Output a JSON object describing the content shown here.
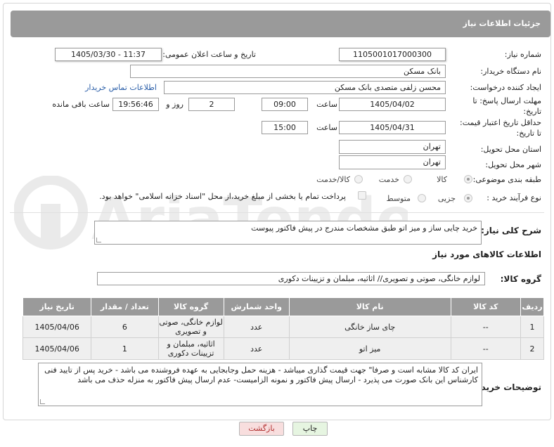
{
  "header": {
    "title": "جزئیات اطلاعات نیاز"
  },
  "fields": {
    "need_number_label": "شماره نیاز:",
    "need_number": "1105001017000300",
    "announce_label": "تاریخ و ساعت اعلان عمومی:",
    "announce_value": "1405/03/30 - 11:37",
    "buyer_org_label": "نام دستگاه خریدار:",
    "buyer_org": "بانک مسکن",
    "requester_label": "ایجاد کننده درخواست:",
    "requester": "محسن زلفی متصدی بانک مسکن",
    "contact_link": "اطلاعات تماس خریدار",
    "deadline_label_1": "مهلت ارسال پاسخ: تا",
    "deadline_label_2": "تاریخ:",
    "deadline_date": "1405/04/02",
    "deadline_time_label": "ساعت",
    "deadline_time": "09:00",
    "deadline_days": "2",
    "deadline_days_label": "روز و",
    "deadline_remaining": "19:56:46",
    "deadline_remaining_label": "ساعت باقی مانده",
    "validity_label_1": "حداقل تاریخ اعتبار قیمت:",
    "validity_label_2": "تا تاریخ:",
    "validity_date": "1405/04/31",
    "validity_time_label": "ساعت",
    "validity_time": "15:00",
    "province_label": "استان محل تحویل:",
    "province": "تهران",
    "city_label": "شهر محل تحویل:",
    "city": "تهران",
    "category_label": "طبقه بندی موضوعی:",
    "category_options": [
      "کالا",
      "خدمت",
      "کالا/خدمت"
    ],
    "process_label": "نوع فرآیند خرید :",
    "process_options": [
      "جزیی",
      "متوسط"
    ],
    "payment_text": "پرداخت تمام یا بخشی از مبلغ خرید،از محل \"اسناد خزانه اسلامی\" خواهد بود."
  },
  "summary": {
    "label": "شرح کلی نیاز:",
    "text": "خرید چایی ساز و میز اتو طبق مشخصات مندرج در پیش فاکتور پیوست"
  },
  "goods_info_title": "اطلاعات کالاهای مورد نیاز",
  "goods_group": {
    "label": "گروه کالا:",
    "value": "لوازم خانگی، صوتی و تصویری// اثاثیه، مبلمان و تزیینات دکوری"
  },
  "table": {
    "headers": [
      "ردیف",
      "کد کالا",
      "نام کالا",
      "واحد شمارش",
      "گروه کالا",
      "تعداد / مقدار",
      "تاریخ نیاز"
    ],
    "rows": [
      [
        "1",
        "--",
        "چای ساز خانگی",
        "عدد",
        "لوازم خانگی، صوتی و تصویری",
        "6",
        "1405/04/06"
      ],
      [
        "2",
        "--",
        "میز اتو",
        "عدد",
        "اثاثیه، مبلمان و تزیینات دکوری",
        "1",
        "1405/04/06"
      ]
    ]
  },
  "buyer_notes": {
    "label": "توضیحات خریدار:",
    "text": "ایران کد کالا مشابه است و صرفا\" جهت قیمت گذاری میباشد - هزینه حمل وجابجایی به عهده فروشنده می باشد - خرید پس از تایید فنی کارشناس این بانک صورت می پذیرد - ارسال پیش فاکتور و نمونه الزامیست- عدم ارسال پیش فاکتور به منزله حذف می باشد"
  },
  "buttons": {
    "print": "چاپ",
    "back": "بازگشت"
  },
  "watermark": "AriaTender.net",
  "colors": {
    "header_bg": "#9a9a9a",
    "link": "#2a5ea8",
    "back_btn": "#f8dede",
    "print_btn": "#e6f5e1"
  }
}
